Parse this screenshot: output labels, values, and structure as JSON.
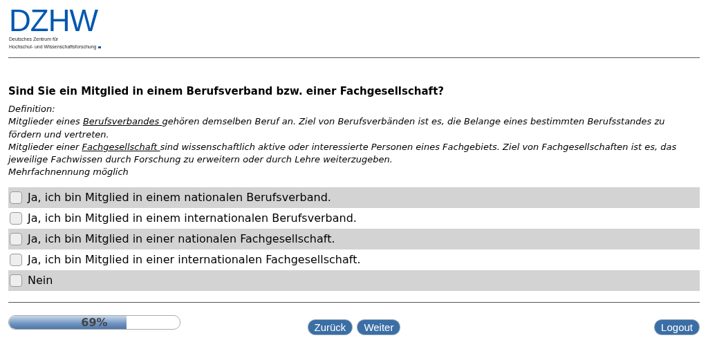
{
  "logo": {
    "mark": "DZHW",
    "subtitle_lines": [
      "Deutsches Zentrum für",
      "Hochschul- und Wissenschaftsforschung"
    ]
  },
  "question": "Sind Sie ein Mitglied in einem Berufsverband bzw. einer Fachgesellschaft?",
  "definition": {
    "label": "Definition:",
    "paragraphs": [
      {
        "before": "Mitglieder eines ",
        "term": "Berufsverbandes ",
        "after": "gehören demselben Beruf an. Ziel von Berufsverbänden ist es, die Belange eines bestimmten Berufsstandes zu fördern und vertreten."
      },
      {
        "before": "Mitglieder einer ",
        "term": "Fachgesellschaft ",
        "after": "sind wissenschaftlich aktive oder interessierte Personen eines Fachgebiets. Ziel von Fachgesellschaften ist es, das jeweilige Fachwissen durch Forschung zu erweitern oder durch Lehre weiterzugeben."
      }
    ],
    "note": "Mehrfachnennung möglich"
  },
  "options": [
    {
      "label": "Ja, ich bin Mitglied in einem nationalen Berufsverband.",
      "checked": false
    },
    {
      "label": "Ja, ich bin Mitglied in einem internationalen Berufsverband.",
      "checked": false
    },
    {
      "label": "Ja, ich bin Mitglied in einer nationalen Fachgesellschaft.",
      "checked": false
    },
    {
      "label": "Ja, ich bin Mitglied in einer internationalen Fachgesellschaft.",
      "checked": false
    },
    {
      "label": "Nein",
      "checked": false
    }
  ],
  "progress": {
    "level": 0.69,
    "label": "69%"
  },
  "buttons": {
    "back": "Zurück",
    "next": "Weiter",
    "logout": "Logout"
  }
}
